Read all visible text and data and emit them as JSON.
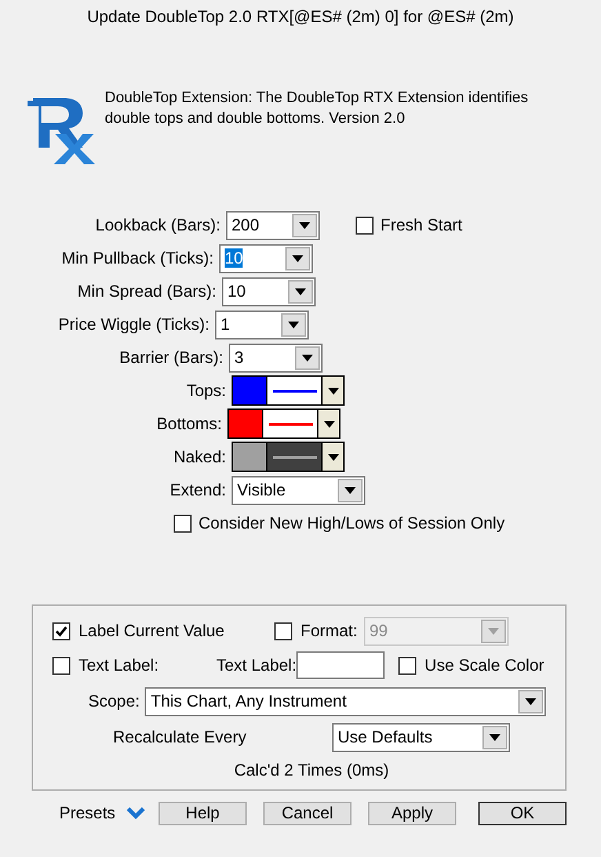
{
  "window": {
    "title": "Update DoubleTop 2.0 RTX[@ES# (2m) 0] for @ES# (2m)"
  },
  "description": "DoubleTop Extension: The DoubleTop RTX Extension identifies double tops and double bottoms. Version 2.0",
  "params": [
    {
      "kind": "dropdown",
      "label": "Lookback (Bars):",
      "value": "200",
      "highlighted": false
    },
    {
      "kind": "dropdown",
      "label": "Min Pullback (Ticks):",
      "value": "10",
      "highlighted": true
    },
    {
      "kind": "dropdown",
      "label": "Min Spread (Bars):",
      "value": "10",
      "highlighted": false
    },
    {
      "kind": "dropdown",
      "label": "Price Wiggle (Ticks):",
      "value": "1",
      "highlighted": false
    },
    {
      "kind": "dropdown",
      "label": "Barrier (Bars):",
      "value": "3",
      "highlighted": false
    },
    {
      "kind": "style",
      "label": "Tops:",
      "color": "#0000ff",
      "dark_background": false
    },
    {
      "kind": "style",
      "label": "Bottoms:",
      "color": "#ff0000",
      "dark_background": false
    },
    {
      "kind": "style",
      "label": "Naked:",
      "color": "#a0a0a0",
      "dark_background": true
    },
    {
      "kind": "dropdown",
      "label": "Extend:",
      "value": "Visible",
      "highlighted": false
    }
  ],
  "fresh_start": {
    "label": "Fresh Start",
    "checked": false
  },
  "session_only": {
    "label": "Consider New High/Lows of Session Only",
    "checked": false
  },
  "label_group": {
    "label_current_value": {
      "label": "Label Current Value",
      "checked": true
    },
    "format": {
      "label": "Format:",
      "checked": false,
      "value": "99",
      "disabled": true
    },
    "text_label_check": {
      "label": "Text Label:",
      "checked": false
    },
    "text_label_field": {
      "label": "Text Label:"
    },
    "use_scale_color": {
      "label": "Use Scale Color",
      "checked": false
    },
    "scope": {
      "label": "Scope:",
      "value": "This Chart, Any Instrument"
    },
    "recalculate": {
      "label": "Recalculate Every",
      "value": "Use Defaults"
    },
    "calc_status": "Calc'd 2 Times (0ms)"
  },
  "presets": "Presets",
  "buttons": [
    "Help",
    "Cancel",
    "Apply",
    "OK"
  ]
}
